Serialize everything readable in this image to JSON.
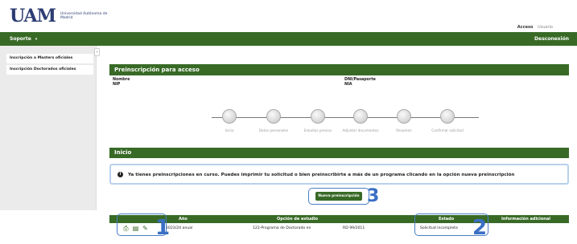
{
  "header": {
    "logo_mark": "UAM",
    "logo_text": "Universidad Autónoma de Madrid",
    "access_label": "Acceso",
    "user_label": "Usuario"
  },
  "nav": {
    "support_label": "Soporte",
    "logout_label": "Desconexión"
  },
  "sidebar": {
    "items": [
      {
        "label": "Inscripción a Masters oficiales"
      },
      {
        "label": "Inscripción Doctorados oficiales"
      }
    ]
  },
  "preinscription": {
    "title": "Preinscripción para acceso",
    "fields": [
      {
        "label": "Nombre",
        "value": "NIP"
      },
      {
        "label": "DNI/Pasaporte",
        "value": "NIA"
      }
    ],
    "steps": [
      {
        "label": "Inicio"
      },
      {
        "label": "Datos personales"
      },
      {
        "label": "Estudios previos"
      },
      {
        "label": "Adjuntar documentos"
      },
      {
        "label": "Resumen"
      },
      {
        "label": "Confirmar solicitud"
      }
    ]
  },
  "inicio": {
    "title": "Inicio",
    "alert": "Ya tienes preinscripciones en curso. Puedes imprimir tu solicitud o bien preinscribirte a más de un programa clicando en la opción nueva preinscripción",
    "new_button": "Nueva preinscripción"
  },
  "table": {
    "headers": [
      "Año",
      "Opción de estudio",
      "Estado",
      "Información adicional"
    ],
    "rows": [
      {
        "year": "2023/24 anual",
        "study_option": "122-Programa de Doctorado en",
        "regulation": "RD 99/2011",
        "status": "Solicitud incompleta",
        "extra": ""
      }
    ]
  },
  "annotations": {
    "actions_number": "1",
    "status_number": "2",
    "button_number": "3",
    "color": "#3a6fc4"
  },
  "theme": {
    "primary_green": "#386a26",
    "alert_border": "#b9d0ec"
  }
}
